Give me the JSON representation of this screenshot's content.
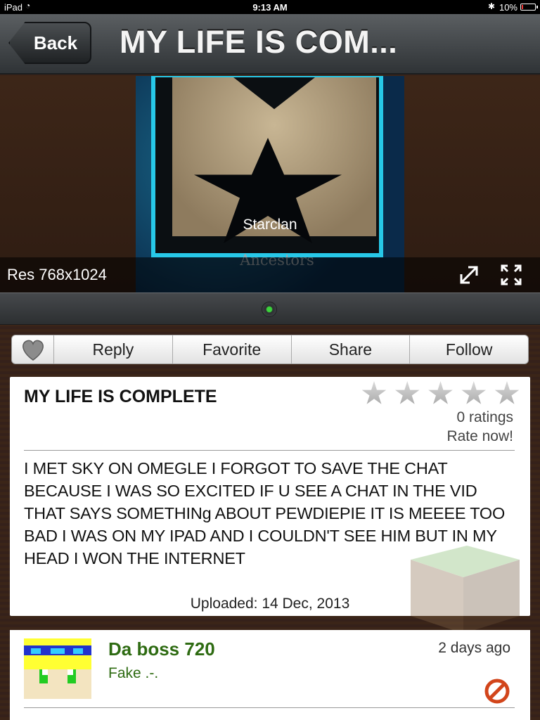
{
  "status_bar": {
    "carrier": "iPad",
    "time": "9:13 AM",
    "battery": "10%",
    "icons": [
      "wifi-icon",
      "bluetooth-icon",
      "battery-icon"
    ]
  },
  "nav": {
    "back_label": "Back",
    "title": "MY LIFE IS COM..."
  },
  "image": {
    "caption": "Starclan",
    "subcaption": "Ancestors",
    "resolution": "Res 768x1024",
    "icons": [
      "expand-icon",
      "fullscreen-icon"
    ]
  },
  "actions": {
    "like_icon": "heart-icon",
    "items": [
      "Reply",
      "Favorite",
      "Share",
      "Follow"
    ]
  },
  "post": {
    "title": "MY LIFE IS COMPLETE",
    "star_count": 5,
    "rating": 0,
    "ratings_label": "0 ratings",
    "rate_now": "Rate now!",
    "body": "I MET SKY ON OMEGLE I FORGOT TO SAVE THE CHAT BECAUSE I WAS SO EXCITED IF U SEE A CHAT IN THE VID THAT SAYS SOMETHINg ABOUT PEWDIEPIE IT IS MEEEE TOO BAD I WAS ON MY IPAD AND I COULDN'T SEE HIM BUT IN MY HEAD I WON THE INTERNET",
    "uploaded": "Uploaded: 14 Dec, 2013"
  },
  "comment": {
    "author": "Da boss 720",
    "text": "Fake .-.",
    "time": "2 days ago",
    "report_icon": "report-icon"
  },
  "colors": {
    "nav_bg": "#3f4346",
    "wood": "#3b2518",
    "comment_author": "#2e6b12",
    "accent_cyan": "#27c8e8",
    "report_red": "#d2451b"
  }
}
